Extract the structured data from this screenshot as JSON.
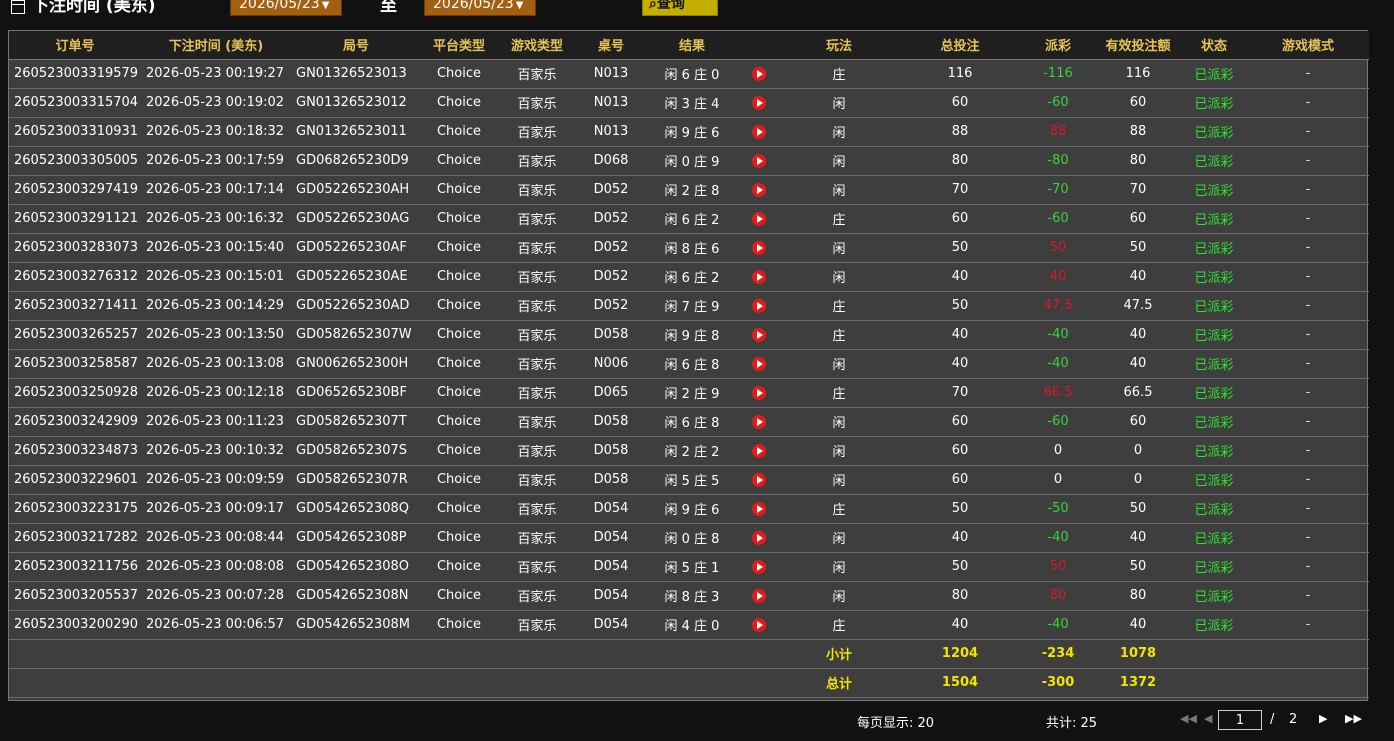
{
  "filter": {
    "label": "下注时间 (美东)",
    "date_from": "2026/05/23",
    "to_label": "至",
    "date_to": "2026/05/23",
    "query_label": "查询"
  },
  "columns": [
    "订单号",
    "下注时间 (美东)",
    "局号",
    "平台类型",
    "游戏类型",
    "桌号",
    "结果",
    "",
    "玩法",
    "总投注",
    "派彩",
    "有效投注额",
    "状态",
    "游戏模式"
  ],
  "rows": [
    {
      "order": "260523003319579",
      "time": "2026-05-23 00:19:27",
      "round": "GN01326523013",
      "platform": "Choice",
      "game": "百家乐",
      "table": "N013",
      "result": "闲 6 庄 0",
      "bet_type": "庄",
      "bet": "116",
      "payout": "-116",
      "payout_sign": "pos",
      "valid": "116",
      "status": "已派彩",
      "mode": "-"
    },
    {
      "order": "260523003315704",
      "time": "2026-05-23 00:19:02",
      "round": "GN01326523012",
      "platform": "Choice",
      "game": "百家乐",
      "table": "N013",
      "result": "闲 3 庄 4",
      "bet_type": "闲",
      "bet": "60",
      "payout": "-60",
      "payout_sign": "pos",
      "valid": "60",
      "status": "已派彩",
      "mode": "-"
    },
    {
      "order": "260523003310931",
      "time": "2026-05-23 00:18:32",
      "round": "GN01326523011",
      "platform": "Choice",
      "game": "百家乐",
      "table": "N013",
      "result": "闲 9 庄 6",
      "bet_type": "闲",
      "bet": "88",
      "payout": "88",
      "payout_sign": "neg",
      "valid": "88",
      "status": "已派彩",
      "mode": "-"
    },
    {
      "order": "260523003305005",
      "time": "2026-05-23 00:17:59",
      "round": "GD068265230D9",
      "platform": "Choice",
      "game": "百家乐",
      "table": "D068",
      "result": "闲 0 庄 9",
      "bet_type": "闲",
      "bet": "80",
      "payout": "-80",
      "payout_sign": "pos",
      "valid": "80",
      "status": "已派彩",
      "mode": "-"
    },
    {
      "order": "260523003297419",
      "time": "2026-05-23 00:17:14",
      "round": "GD052265230AH",
      "platform": "Choice",
      "game": "百家乐",
      "table": "D052",
      "result": "闲 2 庄 8",
      "bet_type": "闲",
      "bet": "70",
      "payout": "-70",
      "payout_sign": "pos",
      "valid": "70",
      "status": "已派彩",
      "mode": "-"
    },
    {
      "order": "260523003291121",
      "time": "2026-05-23 00:16:32",
      "round": "GD052265230AG",
      "platform": "Choice",
      "game": "百家乐",
      "table": "D052",
      "result": "闲 6 庄 2",
      "bet_type": "庄",
      "bet": "60",
      "payout": "-60",
      "payout_sign": "pos",
      "valid": "60",
      "status": "已派彩",
      "mode": "-"
    },
    {
      "order": "260523003283073",
      "time": "2026-05-23 00:15:40",
      "round": "GD052265230AF",
      "platform": "Choice",
      "game": "百家乐",
      "table": "D052",
      "result": "闲 8 庄 6",
      "bet_type": "闲",
      "bet": "50",
      "payout": "50",
      "payout_sign": "neg",
      "valid": "50",
      "status": "已派彩",
      "mode": "-"
    },
    {
      "order": "260523003276312",
      "time": "2026-05-23 00:15:01",
      "round": "GD052265230AE",
      "platform": "Choice",
      "game": "百家乐",
      "table": "D052",
      "result": "闲 6 庄 2",
      "bet_type": "闲",
      "bet": "40",
      "payout": "40",
      "payout_sign": "neg",
      "valid": "40",
      "status": "已派彩",
      "mode": "-"
    },
    {
      "order": "260523003271411",
      "time": "2026-05-23 00:14:29",
      "round": "GD052265230AD",
      "platform": "Choice",
      "game": "百家乐",
      "table": "D052",
      "result": "闲 7 庄 9",
      "bet_type": "庄",
      "bet": "50",
      "payout": "47.5",
      "payout_sign": "neg",
      "valid": "47.5",
      "status": "已派彩",
      "mode": "-"
    },
    {
      "order": "260523003265257",
      "time": "2026-05-23 00:13:50",
      "round": "GD0582652307W",
      "platform": "Choice",
      "game": "百家乐",
      "table": "D058",
      "result": "闲 9 庄 8",
      "bet_type": "庄",
      "bet": "40",
      "payout": "-40",
      "payout_sign": "pos",
      "valid": "40",
      "status": "已派彩",
      "mode": "-"
    },
    {
      "order": "260523003258587",
      "time": "2026-05-23 00:13:08",
      "round": "GN0062652300H",
      "platform": "Choice",
      "game": "百家乐",
      "table": "N006",
      "result": "闲 6 庄 8",
      "bet_type": "闲",
      "bet": "40",
      "payout": "-40",
      "payout_sign": "pos",
      "valid": "40",
      "status": "已派彩",
      "mode": "-"
    },
    {
      "order": "260523003250928",
      "time": "2026-05-23 00:12:18",
      "round": "GD065265230BF",
      "platform": "Choice",
      "game": "百家乐",
      "table": "D065",
      "result": "闲 2 庄 9",
      "bet_type": "庄",
      "bet": "70",
      "payout": "66.5",
      "payout_sign": "neg",
      "valid": "66.5",
      "status": "已派彩",
      "mode": "-"
    },
    {
      "order": "260523003242909",
      "time": "2026-05-23 00:11:23",
      "round": "GD0582652307T",
      "platform": "Choice",
      "game": "百家乐",
      "table": "D058",
      "result": "闲 6 庄 8",
      "bet_type": "闲",
      "bet": "60",
      "payout": "-60",
      "payout_sign": "pos",
      "valid": "60",
      "status": "已派彩",
      "mode": "-"
    },
    {
      "order": "260523003234873",
      "time": "2026-05-23 00:10:32",
      "round": "GD0582652307S",
      "platform": "Choice",
      "game": "百家乐",
      "table": "D058",
      "result": "闲 2 庄 2",
      "bet_type": "闲",
      "bet": "60",
      "payout": "0",
      "payout_sign": "zero",
      "valid": "0",
      "status": "已派彩",
      "mode": "-"
    },
    {
      "order": "260523003229601",
      "time": "2026-05-23 00:09:59",
      "round": "GD0582652307R",
      "platform": "Choice",
      "game": "百家乐",
      "table": "D058",
      "result": "闲 5 庄 5",
      "bet_type": "闲",
      "bet": "60",
      "payout": "0",
      "payout_sign": "zero",
      "valid": "0",
      "status": "已派彩",
      "mode": "-"
    },
    {
      "order": "260523003223175",
      "time": "2026-05-23 00:09:17",
      "round": "GD0542652308Q",
      "platform": "Choice",
      "game": "百家乐",
      "table": "D054",
      "result": "闲 9 庄 6",
      "bet_type": "庄",
      "bet": "50",
      "payout": "-50",
      "payout_sign": "pos",
      "valid": "50",
      "status": "已派彩",
      "mode": "-"
    },
    {
      "order": "260523003217282",
      "time": "2026-05-23 00:08:44",
      "round": "GD0542652308P",
      "platform": "Choice",
      "game": "百家乐",
      "table": "D054",
      "result": "闲 0 庄 8",
      "bet_type": "闲",
      "bet": "40",
      "payout": "-40",
      "payout_sign": "pos",
      "valid": "40",
      "status": "已派彩",
      "mode": "-"
    },
    {
      "order": "260523003211756",
      "time": "2026-05-23 00:08:08",
      "round": "GD0542652308O",
      "platform": "Choice",
      "game": "百家乐",
      "table": "D054",
      "result": "闲 5 庄 1",
      "bet_type": "闲",
      "bet": "50",
      "payout": "50",
      "payout_sign": "neg",
      "valid": "50",
      "status": "已派彩",
      "mode": "-"
    },
    {
      "order": "260523003205537",
      "time": "2026-05-23 00:07:28",
      "round": "GD0542652308N",
      "platform": "Choice",
      "game": "百家乐",
      "table": "D054",
      "result": "闲 8 庄 3",
      "bet_type": "闲",
      "bet": "80",
      "payout": "80",
      "payout_sign": "neg",
      "valid": "80",
      "status": "已派彩",
      "mode": "-"
    },
    {
      "order": "260523003200290",
      "time": "2026-05-23 00:06:57",
      "round": "GD0542652308M",
      "platform": "Choice",
      "game": "百家乐",
      "table": "D054",
      "result": "闲 4 庄 0",
      "bet_type": "庄",
      "bet": "40",
      "payout": "-40",
      "payout_sign": "pos",
      "valid": "40",
      "status": "已派彩",
      "mode": "-"
    }
  ],
  "subtotal": {
    "label": "小计",
    "bet": "1204",
    "payout": "-234",
    "valid": "1078"
  },
  "total": {
    "label": "总计",
    "bet": "1504",
    "payout": "-300",
    "valid": "1372"
  },
  "pagination": {
    "per_page_label": "每页显示: 20",
    "total_label": "共计: 25",
    "current_page": "1",
    "slash": "/",
    "total_pages": "2"
  },
  "colors": {
    "header_text": "#e7c255",
    "payout_positive": "#3ad23a",
    "payout_negative": "#d31a2a",
    "status": "#2ee22e",
    "summary": "#f3e500",
    "date_box": "#a36011",
    "query_button": "#c4ae00"
  }
}
